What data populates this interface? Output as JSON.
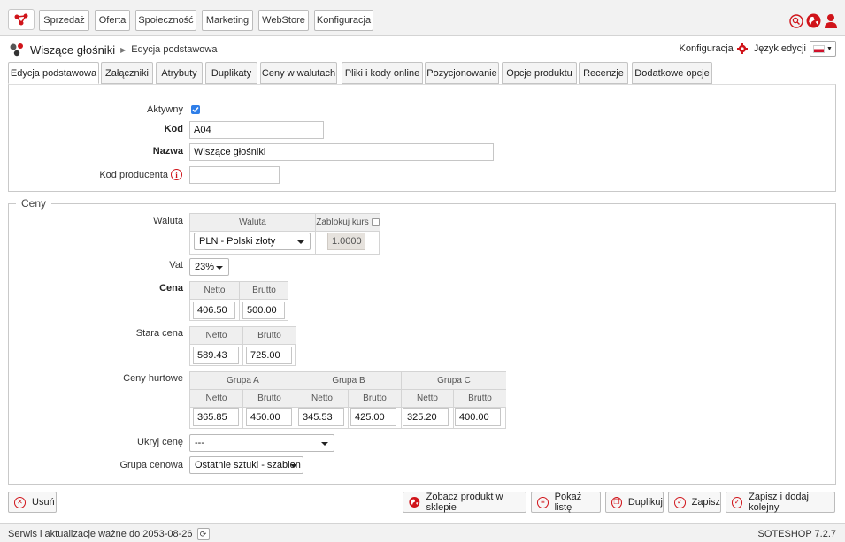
{
  "nav": {
    "items": [
      "Sprzedaż",
      "Oferta",
      "Społeczność",
      "Marketing",
      "WebStore",
      "Konfiguracja"
    ]
  },
  "breadcrumb": {
    "product": "Wiszące głośniki",
    "section": "Edycja podstawowa"
  },
  "tools": {
    "config_label": "Konfiguracja",
    "lang_label": "Język edycji"
  },
  "tabs": [
    "Edycja podstawowa",
    "Załączniki",
    "Atrybuty",
    "Duplikaty",
    "Ceny w walutach",
    "Pliki i kody online",
    "Pozycjonowanie",
    "Opcje produktu",
    "Recenzje",
    "Dodatkowe opcje"
  ],
  "basic": {
    "active_label": "Aktywny",
    "active_checked": true,
    "code_label": "Kod",
    "code_value": "A04",
    "name_label": "Nazwa",
    "name_value": "Wiszące głośniki",
    "producer_code_label": "Kod producenta",
    "producer_code_value": ""
  },
  "prices": {
    "legend": "Ceny",
    "currency_label": "Waluta",
    "currency_header": "Waluta",
    "lock_rate_header": "Zablokuj kurs",
    "currency_value": "PLN - Polski złoty",
    "rate_value": "1.0000",
    "vat_label": "Vat",
    "vat_value": "23%",
    "price_label": "Cena",
    "netto": "Netto",
    "brutto": "Brutto",
    "price_netto": "406.50",
    "price_brutto": "500.00",
    "old_price_label": "Stara cena",
    "old_netto": "589.43",
    "old_brutto": "725.00",
    "wholesale_label": "Ceny hurtowe",
    "groups": [
      {
        "name": "Grupa A",
        "netto": "365.85",
        "brutto": "450.00"
      },
      {
        "name": "Grupa B",
        "netto": "345.53",
        "brutto": "425.00"
      },
      {
        "name": "Grupa C",
        "netto": "325.20",
        "brutto": "400.00"
      }
    ],
    "hide_price_label": "Ukryj cenę",
    "hide_price_value": "---",
    "price_group_label": "Grupa cenowa",
    "price_group_value": "Ostatnie sztuki - szablon"
  },
  "actions": {
    "delete": "Usuń",
    "view_in_shop": "Zobacz produkt w sklepie",
    "show_list": "Pokaż listę",
    "duplicate": "Duplikuj",
    "save": "Zapisz",
    "save_add_next": "Zapisz i dodaj kolejny"
  },
  "footer": {
    "service_text": "Serwis i aktualizacje ważne do 2053-08-26",
    "version": "SOTESHOP 7.2.7"
  },
  "colors": {
    "accent_red": "#d0141a",
    "checkbox_blue": "#2f7ee8"
  }
}
